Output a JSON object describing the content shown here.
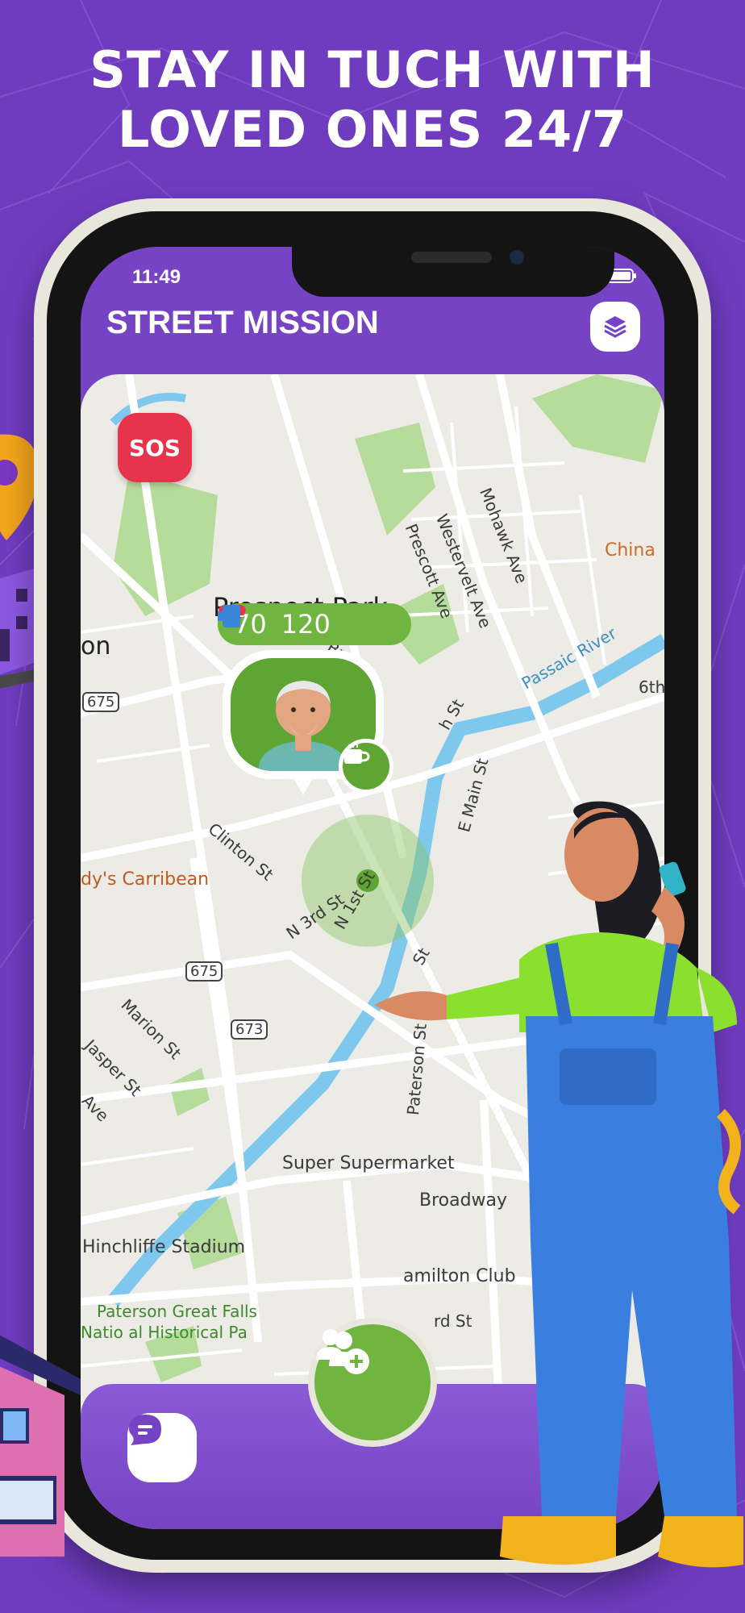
{
  "headline": {
    "line1": "STAY IN TUCH WITH",
    "line2": "LOVED ONES 24/7"
  },
  "status_bar": {
    "time": "11:49",
    "icons": [
      "signal-icon",
      "wifi-icon",
      "battery-icon"
    ]
  },
  "app": {
    "title": "STREET MISSION",
    "layers_icon": "layers-icon"
  },
  "sos": {
    "label": "SOS"
  },
  "vitals": {
    "heart_rate": "70",
    "heart_icon": "heart-pulse-icon",
    "battery_value": "120",
    "battery_icon": "device-battery-icon"
  },
  "person_marker": {
    "avatar_icon": "elderly-man-avatar",
    "activity_icon": "coffee-cup-icon"
  },
  "map": {
    "labels": {
      "prospect_park": "Prospect Park",
      "on": "on",
      "mohawk": "Mohawk Ave",
      "westervelt": "Westervelt Ave",
      "prescott": "Prescott Ave",
      "china": "China",
      "passaic": "Passaic River",
      "sixth": "6th",
      "br": "Br",
      "h_st": "h St",
      "e_main": "E Main St",
      "clinton": "Clinton St",
      "n3rd": "N 3rd St",
      "n1st": "N 1st St",
      "st": "St",
      "caribbean": "dy's Carribean",
      "marion": "Marion St",
      "jasper": "Jasper St",
      "ave": "Ave",
      "paterson_st": "Paterson St",
      "supermarket": "Super Supermarket",
      "broadway": "Broadway",
      "hinchliffe": "Hinchliffe Stadium",
      "hamilton": "amilton Club",
      "falls": "Paterson Great Falls",
      "nat_park": "Natio al Historical Pa",
      "rd_st": "rd St",
      "h": "h"
    },
    "route_shields": {
      "r675a": "675",
      "r675b": "675",
      "r673": "673"
    }
  },
  "bottom_nav": {
    "chat_icon": "chat-icon",
    "add_people_icon": "add-people-icon"
  },
  "colors": {
    "background": "#6f3cc0",
    "app_purple": "#7643c4",
    "green": "#6fb53f",
    "sos_red": "#e8334d"
  }
}
